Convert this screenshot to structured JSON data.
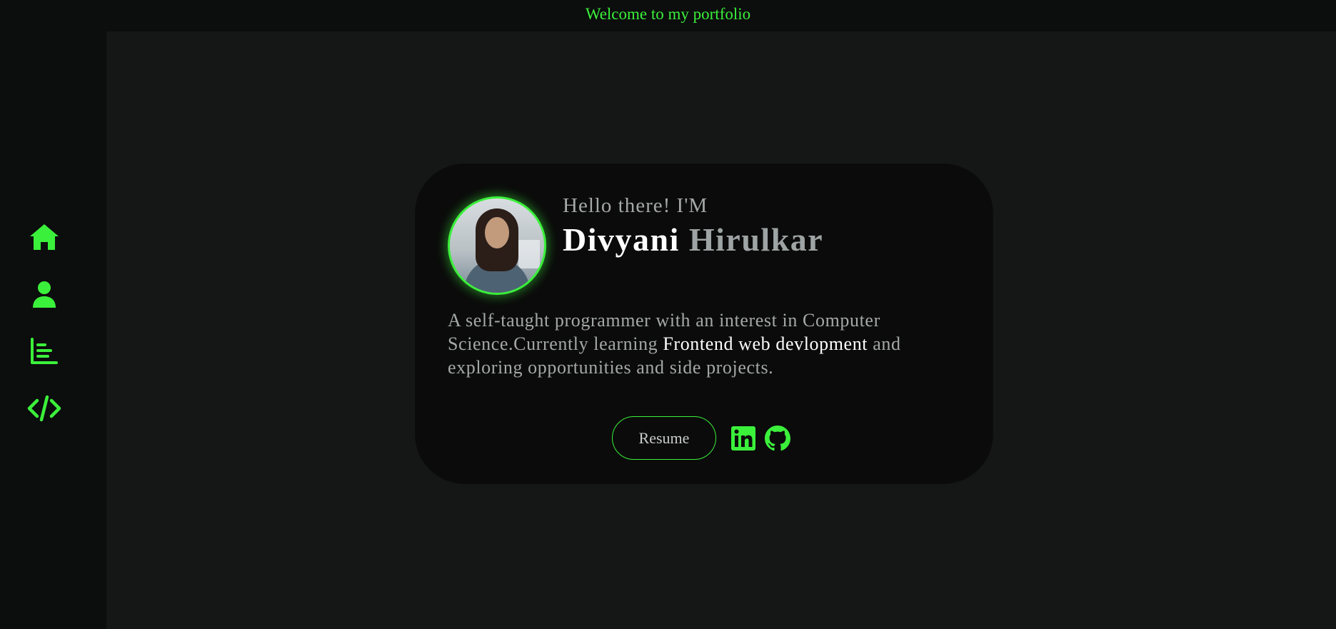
{
  "header": {
    "welcome_text": "Welcome to my portfolio"
  },
  "sidebar": {
    "items": [
      {
        "icon": "home-icon"
      },
      {
        "icon": "user-icon"
      },
      {
        "icon": "chart-icon"
      },
      {
        "icon": "code-icon"
      }
    ]
  },
  "hero": {
    "greeting": "Hello there! I'M",
    "first_name": "Divyani",
    "last_name": "Hirulkar",
    "bio_part1": "A self-taught programmer with an interest in Computer Science.Currently learning ",
    "bio_highlight": "Frontend web devlopment",
    "bio_part2": " and exploring opportunities and side projects.",
    "resume_label": "Resume",
    "socials": [
      {
        "icon": "linkedin-icon"
      },
      {
        "icon": "github-icon"
      }
    ]
  },
  "colors": {
    "accent": "#3bf03b",
    "background": "#151716",
    "sidebar": "#0c0d0d",
    "card": "#0b0b0b",
    "muted_text": "#a5a8a8"
  }
}
